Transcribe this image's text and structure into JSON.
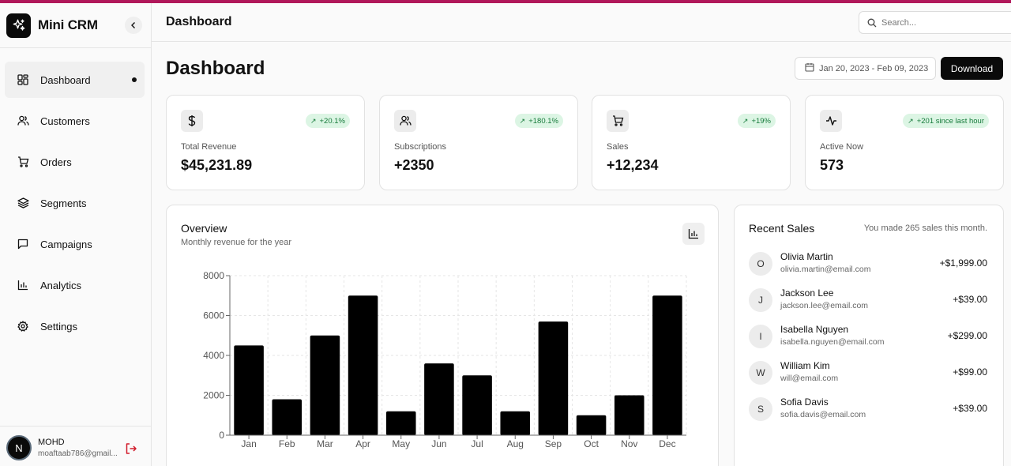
{
  "app": {
    "name": "Mini CRM"
  },
  "sidebar": {
    "items": [
      {
        "label": "Dashboard",
        "icon": "layout-grid-icon",
        "active": true
      },
      {
        "label": "Customers",
        "icon": "users-icon"
      },
      {
        "label": "Orders",
        "icon": "cart-icon"
      },
      {
        "label": "Segments",
        "icon": "layers-icon"
      },
      {
        "label": "Campaigns",
        "icon": "message-icon"
      },
      {
        "label": "Analytics",
        "icon": "bar-chart-icon"
      },
      {
        "label": "Settings",
        "icon": "gear-icon"
      }
    ],
    "user": {
      "initial": "N",
      "name": "MOHD",
      "email": "moaftaab786@gmail..."
    }
  },
  "header": {
    "title": "Dashboard",
    "search_placeholder": "Search..."
  },
  "main": {
    "title": "Dashboard",
    "date_range": "Jan 20, 2023 - Feb 09, 2023",
    "download_label": "Download",
    "stats": [
      {
        "label": "Total Revenue",
        "value": "$45,231.89",
        "badge": "+20.1%",
        "icon": "dollar-icon"
      },
      {
        "label": "Subscriptions",
        "value": "+2350",
        "badge": "+180.1%",
        "icon": "users-icon"
      },
      {
        "label": "Sales",
        "value": "+12,234",
        "badge": "+19%",
        "icon": "cart-icon"
      },
      {
        "label": "Active Now",
        "value": "573",
        "badge": "+201 since last hour",
        "icon": "activity-icon"
      }
    ],
    "overview": {
      "title": "Overview",
      "subtitle": "Monthly revenue for the year"
    },
    "recent_sales": {
      "title": "Recent Sales",
      "subtitle": "You made 265 sales this month.",
      "items": [
        {
          "initial": "O",
          "name": "Olivia Martin",
          "email": "olivia.martin@email.com",
          "amount": "+$1,999.00"
        },
        {
          "initial": "J",
          "name": "Jackson Lee",
          "email": "jackson.lee@email.com",
          "amount": "+$39.00"
        },
        {
          "initial": "I",
          "name": "Isabella Nguyen",
          "email": "isabella.nguyen@email.com",
          "amount": "+$299.00"
        },
        {
          "initial": "W",
          "name": "William Kim",
          "email": "will@email.com",
          "amount": "+$99.00"
        },
        {
          "initial": "S",
          "name": "Sofia Davis",
          "email": "sofia.davis@email.com",
          "amount": "+$39.00"
        }
      ]
    }
  },
  "colors": {
    "accent_bar": "#b0175a",
    "bar": "#000000",
    "badge_bg": "#dcf5e4",
    "badge_text": "#157a3a",
    "logout": "#d11a2a"
  },
  "chart_data": {
    "type": "bar",
    "categories": [
      "Jan",
      "Feb",
      "Mar",
      "Apr",
      "May",
      "Jun",
      "Jul",
      "Aug",
      "Sep",
      "Oct",
      "Nov",
      "Dec"
    ],
    "values": [
      4500,
      1800,
      5000,
      7000,
      1200,
      3600,
      3000,
      1200,
      5700,
      1000,
      2000,
      7000
    ],
    "ylim": [
      0,
      8000
    ],
    "yticks": [
      0,
      2000,
      4000,
      6000,
      8000
    ],
    "grid": true,
    "xlabel": "",
    "ylabel": ""
  }
}
